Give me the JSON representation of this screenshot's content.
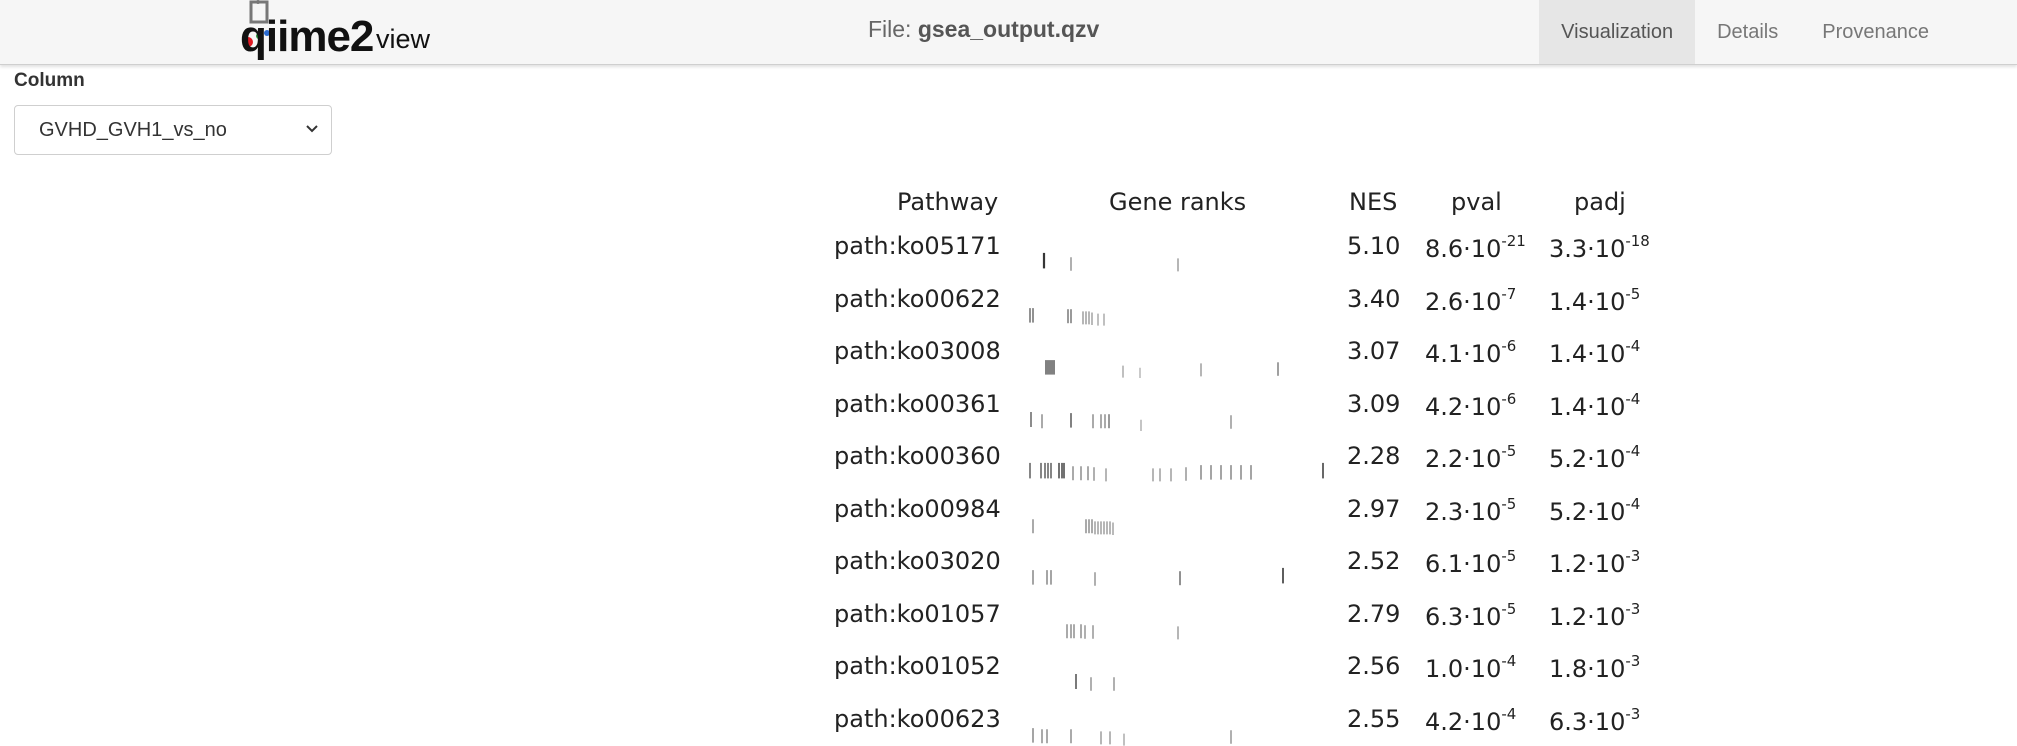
{
  "header": {
    "logo_text_q": "qiime2",
    "logo_text_view": "view",
    "file_label": "File:",
    "file_name": "gsea_output.qzv",
    "tabs": [
      "Visualization",
      "Details",
      "Provenance"
    ]
  },
  "controls": {
    "column_label": "Column",
    "column_value": "GVHD_GVH1_vs_no"
  },
  "table": {
    "headers": [
      "Pathway",
      "Gene ranks",
      "NES",
      "pval",
      "padj"
    ],
    "rows": [
      {
        "pathway": "path:ko05171",
        "nes": "5.10",
        "pval_m": "8.6·10",
        "pval_e": "-21",
        "padj_m": "3.3·10",
        "padj_e": "-18",
        "ranks": [
          [
            16,
            0.55,
            2.2
          ],
          [
            43,
            0.35,
            1
          ],
          [
            150,
            0.3,
            1
          ]
        ]
      },
      {
        "pathway": "path:ko00622",
        "nes": "3.40",
        "pval_m": "2.6·10",
        "pval_e": "-7",
        "padj_m": "1.4·10",
        "padj_e": "-5",
        "ranks": [
          [
            2,
            0.45,
            1.2
          ],
          [
            5,
            0.45,
            1.2
          ],
          [
            40,
            0.4,
            1.2
          ],
          [
            43,
            0.4,
            1.2
          ],
          [
            55,
            0.3,
            1
          ],
          [
            58,
            0.3,
            1
          ],
          [
            61,
            0.3,
            1
          ],
          [
            64,
            0.25,
            1
          ],
          [
            70,
            0.2,
            1
          ],
          [
            76,
            0.2,
            1
          ]
        ]
      },
      {
        "pathway": "path:ko03008",
        "nes": "3.07",
        "pval_m": "4.1·10",
        "pval_e": "-6",
        "padj_m": "1.4·10",
        "padj_e": "-4",
        "ranks": [
          [
            18,
            0.45,
            1.4
          ],
          [
            20,
            0.45,
            1.4
          ],
          [
            22,
            0.45,
            1.4
          ],
          [
            24,
            0.45,
            1.4
          ],
          [
            26,
            0.45,
            1.4
          ],
          [
            95,
            0.2,
            1
          ],
          [
            112,
            0.1,
            1
          ],
          [
            173,
            0.3,
            1
          ],
          [
            250,
            0.35,
            1.2
          ]
        ]
      },
      {
        "pathway": "path:ko00361",
        "nes": "3.09",
        "pval_m": "4.2·10",
        "pval_e": "-6",
        "padj_m": "1.4·10",
        "padj_e": "-4",
        "ranks": [
          [
            3,
            0.5,
            1.2
          ],
          [
            14,
            0.4,
            1
          ],
          [
            43,
            0.45,
            1.4
          ],
          [
            65,
            0.4,
            1
          ],
          [
            73,
            0.4,
            1
          ],
          [
            77,
            0.4,
            1
          ],
          [
            81,
            0.4,
            1.2
          ],
          [
            113,
            0.15,
            1
          ],
          [
            203,
            0.35,
            1
          ]
        ]
      },
      {
        "pathway": "path:ko00360",
        "nes": "2.28",
        "pval_m": "2.2·10",
        "pval_e": "-5",
        "padj_m": "5.2·10",
        "padj_e": "-4",
        "ranks": [
          [
            2,
            0.55,
            1.2
          ],
          [
            13,
            0.55,
            1.2
          ],
          [
            17,
            0.55,
            1.2
          ],
          [
            20,
            0.55,
            1.2
          ],
          [
            23,
            0.55,
            1.2
          ],
          [
            31,
            0.55,
            1.4
          ],
          [
            34,
            0.55,
            1.4
          ],
          [
            36,
            0.55,
            1.4
          ],
          [
            45,
            0.4,
            1
          ],
          [
            53,
            0.4,
            1
          ],
          [
            60,
            0.4,
            1
          ],
          [
            66,
            0.35,
            1
          ],
          [
            78,
            0.3,
            1
          ],
          [
            125,
            0.3,
            1
          ],
          [
            132,
            0.3,
            1
          ],
          [
            143,
            0.3,
            1
          ],
          [
            158,
            0.35,
            1
          ],
          [
            173,
            0.45,
            1
          ],
          [
            183,
            0.45,
            1
          ],
          [
            193,
            0.45,
            1
          ],
          [
            203,
            0.45,
            1
          ],
          [
            213,
            0.45,
            1
          ],
          [
            223,
            0.45,
            1
          ],
          [
            295,
            0.55,
            1.5
          ]
        ]
      },
      {
        "pathway": "path:ko00984",
        "nes": "2.97",
        "pval_m": "2.3·10",
        "pval_e": "-5",
        "padj_m": "5.2·10",
        "padj_e": "-4",
        "ranks": [
          [
            5,
            0.4,
            1
          ],
          [
            58,
            0.4,
            1
          ],
          [
            61,
            0.4,
            1
          ],
          [
            64,
            0.4,
            1
          ],
          [
            67,
            0.3,
            1
          ],
          [
            70,
            0.3,
            1
          ],
          [
            73,
            0.3,
            1
          ],
          [
            76,
            0.3,
            1
          ],
          [
            79,
            0.3,
            1
          ],
          [
            82,
            0.3,
            1
          ],
          [
            85,
            0.25,
            1
          ]
        ]
      },
      {
        "pathway": "path:ko03020",
        "nes": "2.52",
        "pval_m": "6.1·10",
        "pval_e": "-5",
        "padj_m": "1.2·10",
        "padj_e": "-3",
        "ranks": [
          [
            5,
            0.45,
            1
          ],
          [
            19,
            0.45,
            1
          ],
          [
            23,
            0.45,
            1
          ],
          [
            67,
            0.35,
            1
          ],
          [
            152,
            0.4,
            1.3
          ],
          [
            255,
            0.55,
            1.6
          ]
        ]
      },
      {
        "pathway": "path:ko01057",
        "nes": "2.79",
        "pval_m": "6.3·10",
        "pval_e": "-5",
        "padj_m": "1.2·10",
        "padj_e": "-3",
        "ranks": [
          [
            39,
            0.4,
            1
          ],
          [
            43,
            0.4,
            1
          ],
          [
            46,
            0.4,
            1
          ],
          [
            53,
            0.4,
            1
          ],
          [
            57,
            0.35,
            1
          ],
          [
            65,
            0.35,
            1
          ],
          [
            150,
            0.3,
            1
          ]
        ]
      },
      {
        "pathway": "path:ko01052",
        "nes": "2.56",
        "pval_m": "1.0·10",
        "pval_e": "-4",
        "padj_m": "1.8·10",
        "padj_e": "-3",
        "ranks": [
          [
            48,
            0.5,
            1.4
          ],
          [
            63,
            0.35,
            1
          ],
          [
            86,
            0.35,
            1
          ]
        ]
      },
      {
        "pathway": "path:ko00623",
        "nes": "2.55",
        "pval_m": "4.2·10",
        "pval_e": "-4",
        "padj_m": "6.3·10",
        "padj_e": "-3",
        "ranks": [
          [
            5,
            0.45,
            1
          ],
          [
            14,
            0.4,
            1
          ],
          [
            19,
            0.4,
            1
          ],
          [
            43,
            0.4,
            1
          ],
          [
            73,
            0.3,
            1
          ],
          [
            82,
            0.3,
            1
          ],
          [
            96,
            0.2,
            1
          ],
          [
            203,
            0.35,
            1
          ]
        ]
      }
    ]
  }
}
